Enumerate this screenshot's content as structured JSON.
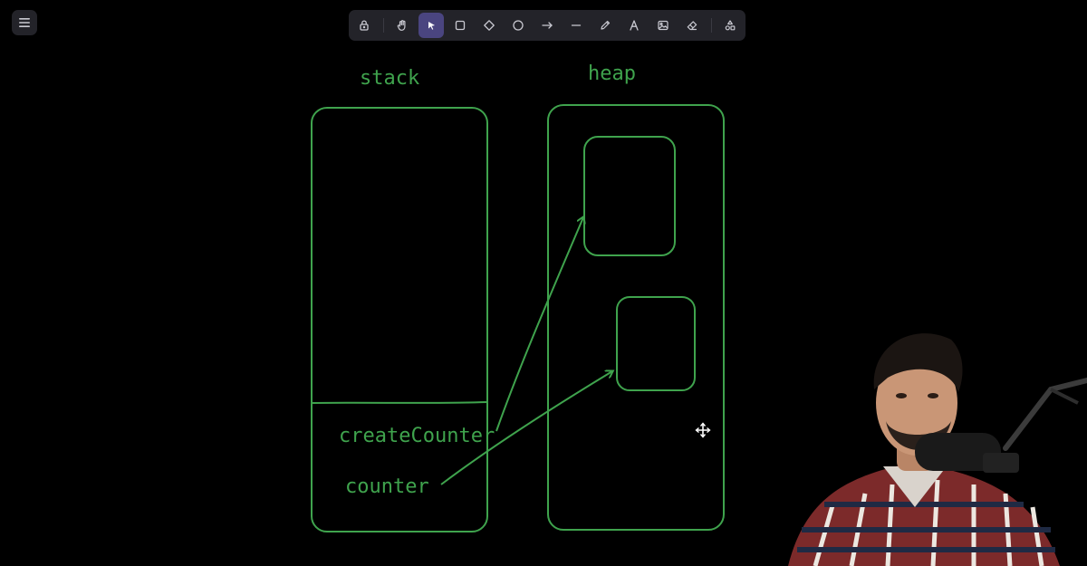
{
  "app": {
    "name": "Whiteboard",
    "menu_icon": "hamburger-menu-icon"
  },
  "toolbar": {
    "tools": [
      {
        "id": "lock",
        "icon": "lock-icon",
        "active": false
      },
      {
        "id": "hand",
        "icon": "hand-icon",
        "active": false
      },
      {
        "id": "selection",
        "icon": "pointer-icon",
        "active": true
      },
      {
        "id": "rectangle",
        "icon": "rectangle-icon",
        "active": false
      },
      {
        "id": "diamond",
        "icon": "diamond-icon",
        "active": false
      },
      {
        "id": "ellipse",
        "icon": "circle-icon",
        "active": false
      },
      {
        "id": "arrow",
        "icon": "arrow-icon",
        "active": false
      },
      {
        "id": "line",
        "icon": "line-icon",
        "active": false
      },
      {
        "id": "draw",
        "icon": "pencil-icon",
        "active": false
      },
      {
        "id": "text",
        "icon": "text-icon",
        "active": false
      },
      {
        "id": "image",
        "icon": "image-icon",
        "active": false
      },
      {
        "id": "eraser",
        "icon": "eraser-icon",
        "active": false
      },
      {
        "id": "more",
        "icon": "shapes-icon",
        "active": false
      }
    ],
    "active_color": "#4a4580"
  },
  "canvas": {
    "stroke_color": "#3fa34d",
    "labels": {
      "stack": "stack",
      "heap": "heap",
      "create_counter": "createCounter",
      "counter": "counter"
    },
    "move_cursor_icon": "move-cursor-icon"
  },
  "presenter": {
    "description_icon": "webcam-presenter"
  }
}
